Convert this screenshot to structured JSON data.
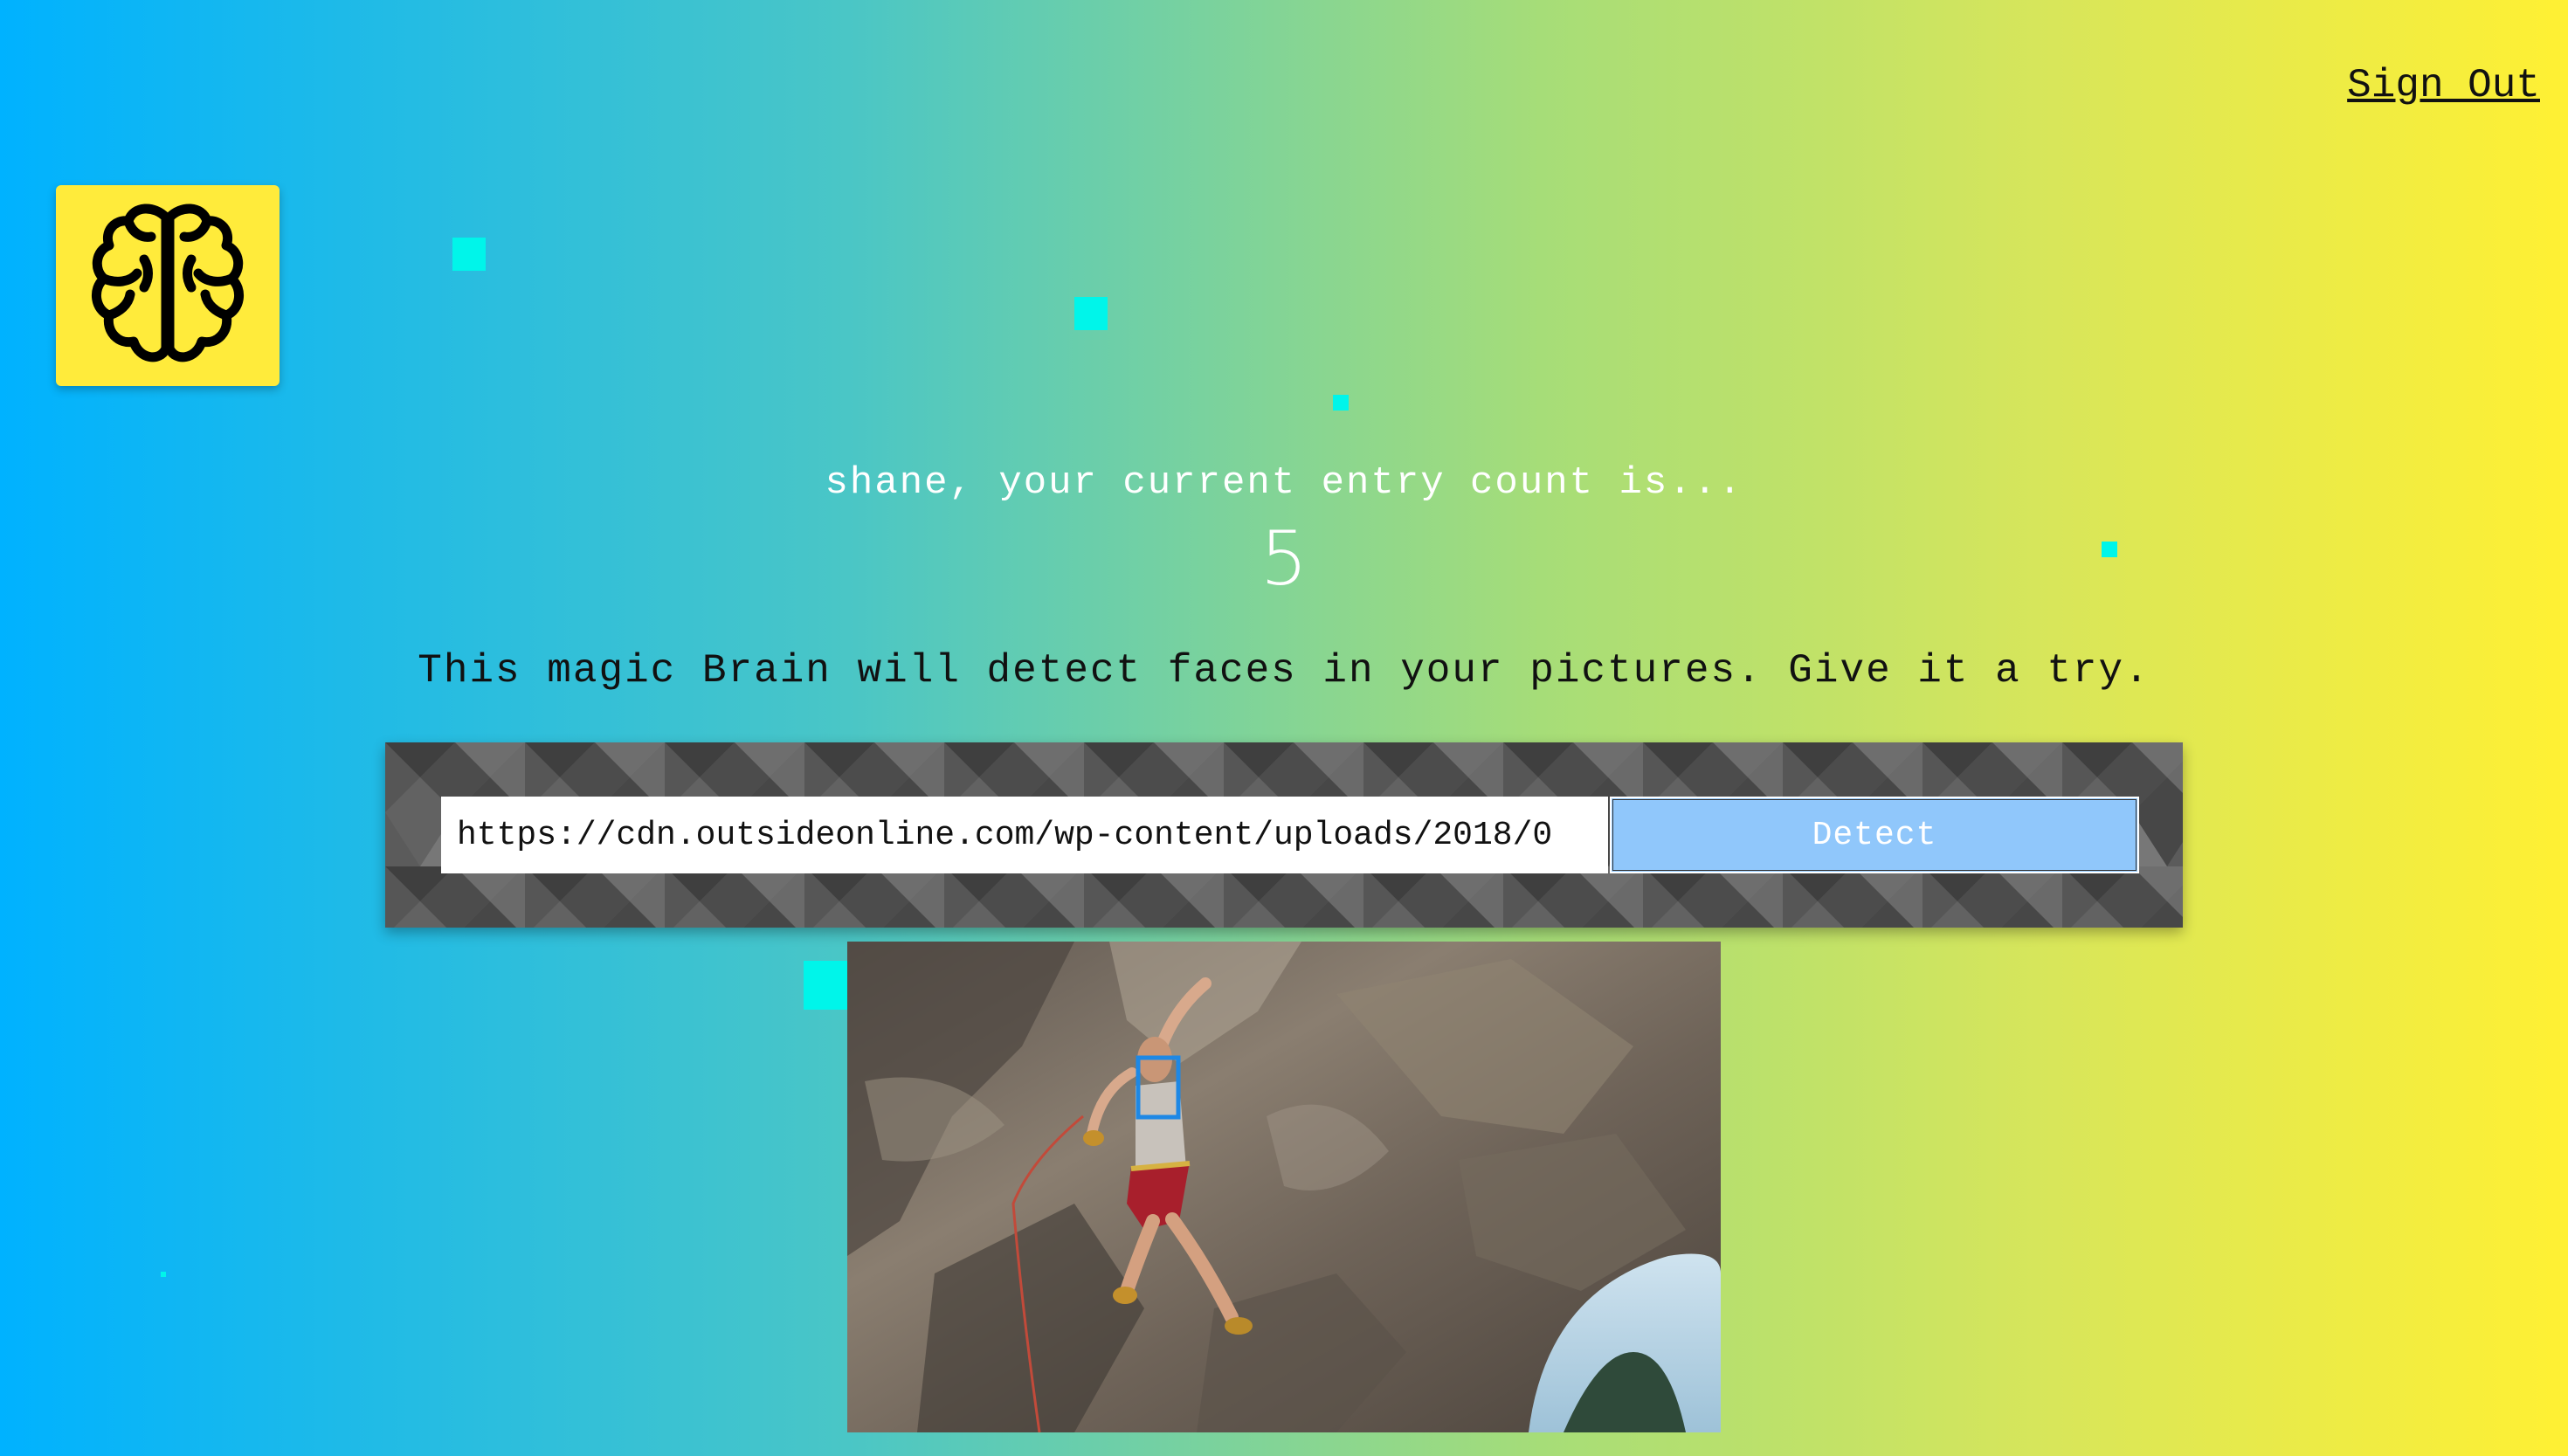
{
  "header": {
    "sign_out_label": "Sign Out",
    "logo_icon": "brain-icon"
  },
  "rank": {
    "greeting": "shane, your current entry count is...",
    "count": "5"
  },
  "main": {
    "tagline": "This magic Brain will detect faces in your pictures. Give it a try.",
    "url_value": "https://cdn.outsideonline.com/wp-content/uploads/2018/0",
    "detect_label": "Detect"
  },
  "image": {
    "subject": "rock-climber-photo",
    "face_box_icon": "face-bounding-box"
  },
  "colors": {
    "gradient_start": "#00b2ff",
    "gradient_end": "#fff033",
    "logo_bg": "#ffeb3b",
    "detect_button": "#90c7fb",
    "face_box": "#1e88e5",
    "particle": "#00f5ea"
  }
}
